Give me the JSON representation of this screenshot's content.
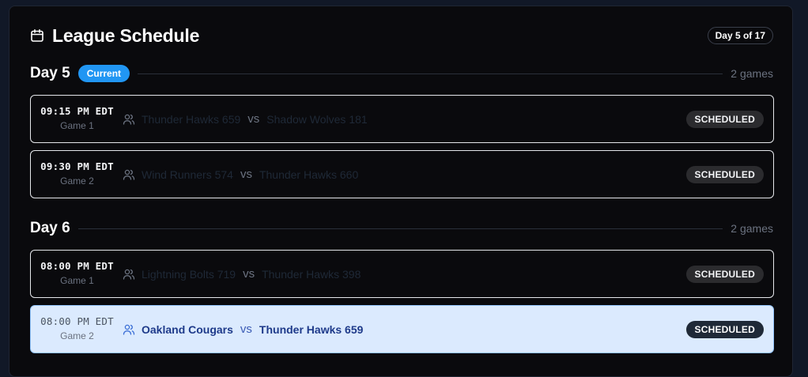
{
  "header": {
    "title": "League Schedule",
    "day_badge": "Day 5 of 17",
    "icon": "calendar-icon"
  },
  "days": [
    {
      "label": "Day 5",
      "current_label": "Current",
      "games_count": "2 games",
      "games": [
        {
          "time": "09:15 PM EDT",
          "game_no": "Game 1",
          "home": "Thunder Hawks 659",
          "vs": "vs",
          "away": "Shadow Wolves 181",
          "status": "SCHEDULED"
        },
        {
          "time": "09:30 PM EDT",
          "game_no": "Game 2",
          "home": "Wind Runners 574",
          "vs": "vs",
          "away": "Thunder Hawks 660",
          "status": "SCHEDULED"
        }
      ]
    },
    {
      "label": "Day 6",
      "games_count": "2 games",
      "games": [
        {
          "time": "08:00 PM EDT",
          "game_no": "Game 1",
          "home": "Lightning Bolts 719",
          "vs": "vs",
          "away": "Thunder Hawks 398",
          "status": "SCHEDULED"
        },
        {
          "time": "08:00 PM EDT",
          "game_no": "Game 2",
          "home": "Oakland Cougars",
          "vs": "vs",
          "away": "Thunder Hawks 659",
          "status": "SCHEDULED",
          "highlighted": true
        }
      ]
    }
  ],
  "colors": {
    "accent": "#2196f3",
    "highlight_bg": "#dbeafe",
    "background": "#0a0a0d"
  }
}
